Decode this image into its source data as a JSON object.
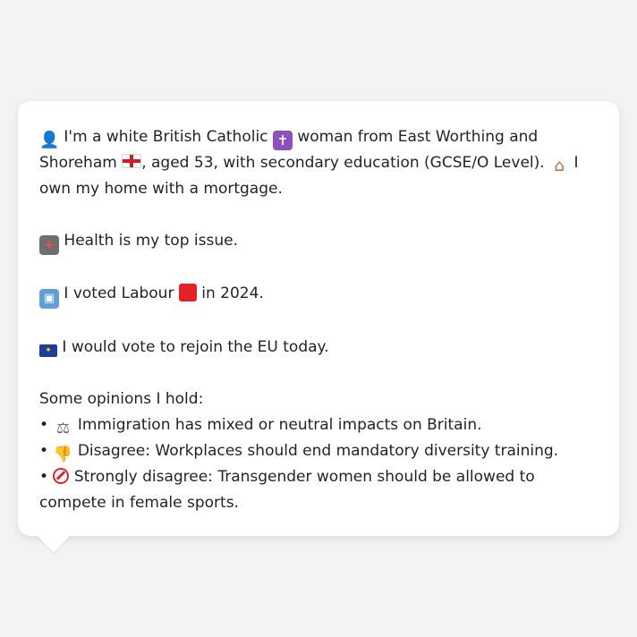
{
  "message": {
    "intro": {
      "t1": "I'm a white British Catholic",
      "t2": "woman from East Worthing and Shoreham",
      "t3": ", aged 53, with secondary education (GCSE/O Level).",
      "t4": "I own my home with a mortgage."
    },
    "health": "Health is my top issue.",
    "vote": {
      "t1": "I voted Labour",
      "t2": "in 2024."
    },
    "eu": "I would vote to rejoin the EU today.",
    "opinions_heading": "Some opinions I hold:",
    "opinions": [
      "Immigration has mixed or neutral impacts on Britain.",
      "Disagree: Workplaces should end mandatory diversity training.",
      "Strongly disagree: Transgender women should be allowed to compete in female sports."
    ],
    "bullet": "•"
  },
  "icons": {
    "person": "person-silhouette-icon",
    "religion": "latin-cross-icon",
    "region": "england-flag-icon",
    "home": "house-icon",
    "health": "hospital-icon",
    "ballot": "ballot-box-icon",
    "party": "red-square-icon",
    "eu": "eu-flag-icon",
    "opinion1": "balance-scale-icon",
    "opinion2": "thumbs-down-icon",
    "opinion3": "no-entry-icon"
  },
  "colors": {
    "background": "#f1f3f5",
    "bubble": "#ffffff",
    "text": "#1e2329",
    "labour_red": "#e62227"
  }
}
